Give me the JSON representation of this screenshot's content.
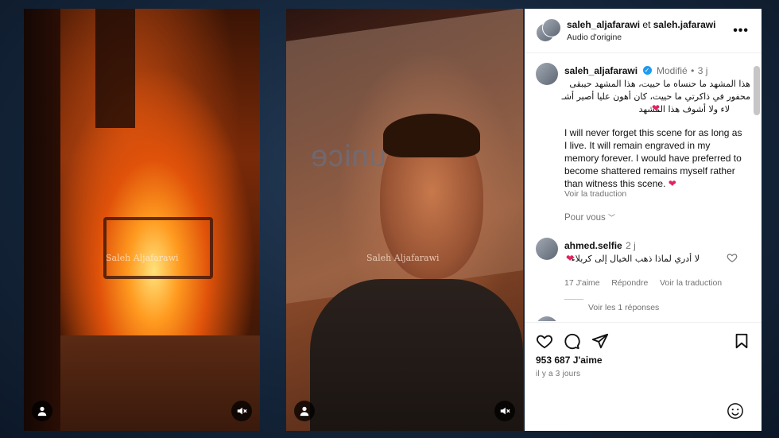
{
  "videos": [
    {
      "watermark": "Saleh Aljafarawi"
    },
    {
      "watermark": "Saleh Aljafarawi",
      "background_text": "unice"
    }
  ],
  "post": {
    "header": {
      "accounts_line": {
        "user1": "saleh_aljafarawi",
        "connector": " et ",
        "user2": "saleh.jafarawi"
      },
      "subtitle": "Audio d'origine",
      "more": "•••"
    },
    "caption": {
      "username": "saleh_aljafarawi",
      "edited": "Modifié",
      "separator": "•",
      "time": "3 j",
      "arabic_lines": [
        "هذا المشهد ما حنساه ما حييت، هذا المشهد حيبقى",
        "محفور في ذاكرتي ما حييت، كان أهون عليا أصير أشـ",
        "لاء ولا أشوف هذا المشهد"
      ],
      "english": "I will never forget this scene for as long as I live. It will remain engraved in my memory forever. I would have preferred to become shattered remains myself rather than witness this scene.",
      "translate": "Voir la traduction"
    },
    "for_you": "Pour vous",
    "comment": {
      "username": "ahmed.selfie",
      "time": "2 j",
      "text": "لا أدري لماذا ذهب الخيال إلى كربلاء",
      "likes": "17 J'aime",
      "reply": "Répondre",
      "translate": "Voir la traduction",
      "view_replies": "Voir les 1 réponses"
    },
    "likes": "953 687 J'aime",
    "date": "il y a 3 jours"
  },
  "colors": {
    "verified": "#1d9bf0",
    "heart": "#e0245e",
    "secondary_text": "#737373"
  }
}
